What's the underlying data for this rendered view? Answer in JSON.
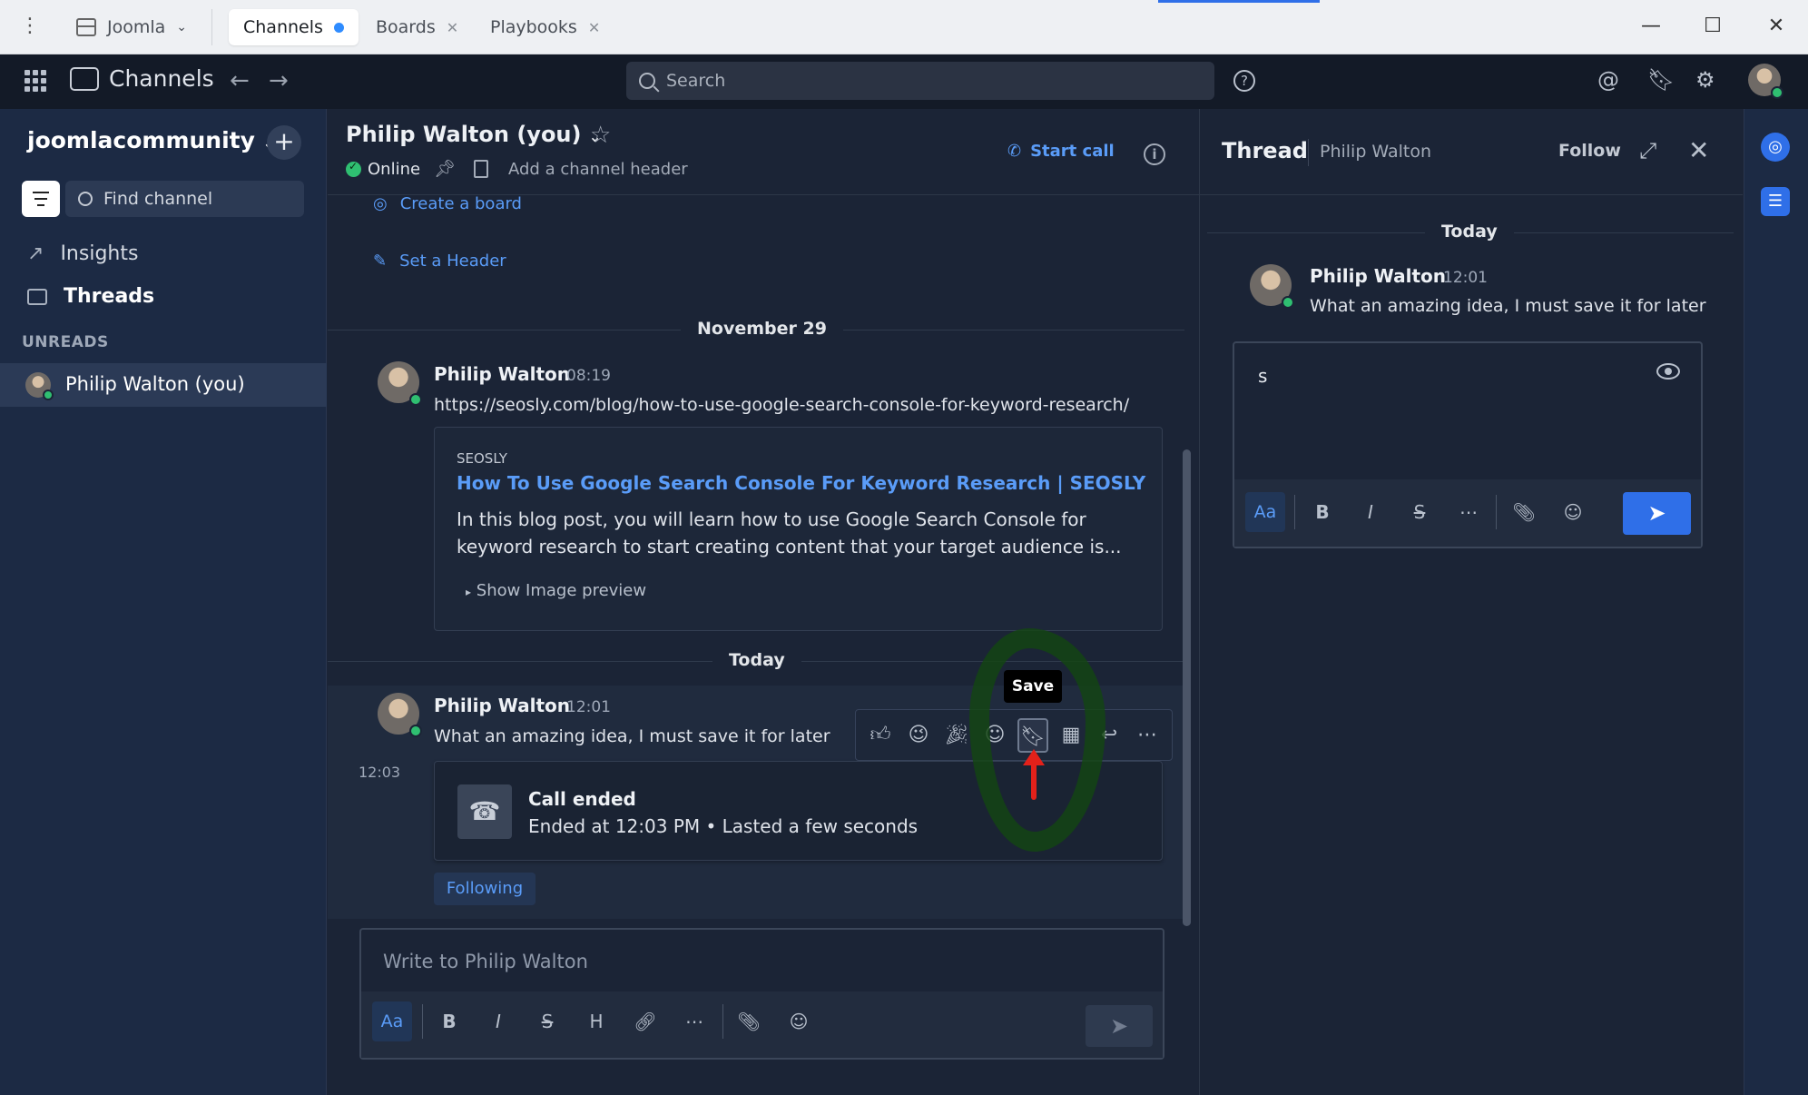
{
  "tabs": {
    "server": "Joomla",
    "items": [
      {
        "label": "Channels",
        "active": true,
        "unread": true
      },
      {
        "label": "Boards",
        "active": false
      },
      {
        "label": "Playbooks",
        "active": false
      }
    ]
  },
  "header": {
    "product": "Channels",
    "search_placeholder": "Search"
  },
  "sidebar": {
    "team_name": "joomlacommunity",
    "find_channel": "Find channel",
    "items": [
      {
        "label": "Insights"
      },
      {
        "label": "Threads"
      }
    ],
    "unreads_label": "UNREADS",
    "dm": "Philip Walton (you)"
  },
  "channel": {
    "title": "Philip Walton (you)",
    "status": "Online",
    "header_placeholder": "Add a channel header",
    "start_call": "Start call",
    "create_board": "Create a board",
    "set_header": "Set a Header"
  },
  "messages": {
    "date1": "November 29",
    "msg1": {
      "author": "Philip Walton",
      "time": "08:19",
      "link": "https://seosly.com/blog/how-to-use-google-search-console-for-keyword-research/"
    },
    "preview": {
      "site": "SEOSLY",
      "title": "How To Use Google Search Console For Keyword Research | SEOSLY",
      "desc": "In this blog post, you will learn how to use Google Search Console for keyword research to start creating content that your target audience is...",
      "show_preview": "Show Image preview"
    },
    "date2": "Today",
    "msg2": {
      "author": "Philip Walton",
      "time": "12:01",
      "text": "What an amazing idea, I must save it for later"
    },
    "call": {
      "time": "12:03",
      "title": "Call ended",
      "sub": "Ended at 12:03 PM • Lasted a few seconds"
    },
    "following": "Following",
    "tooltip": "Save"
  },
  "composer": {
    "placeholder": "Write to Philip Walton",
    "aa": "Aa"
  },
  "thread": {
    "title": "Thread",
    "subtitle": "Philip Walton",
    "follow": "Follow",
    "date": "Today",
    "author": "Philip Walton",
    "time": "12:01",
    "text": "What an amazing idea, I must save it for later",
    "draft": "s",
    "aa": "Aa"
  }
}
